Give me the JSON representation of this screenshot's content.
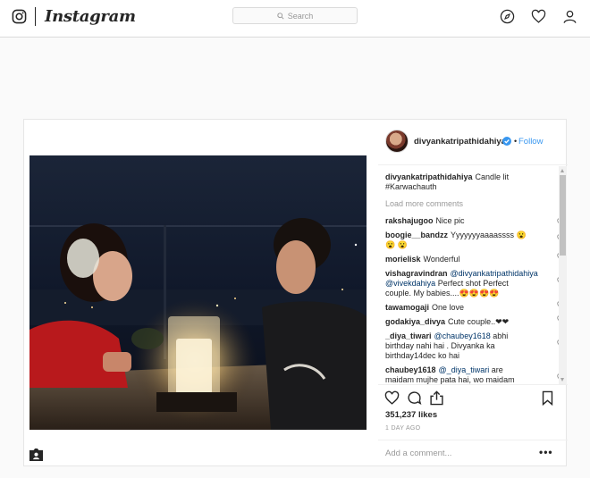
{
  "nav": {
    "brand": "Instagram",
    "search_placeholder": "Search",
    "icons": [
      "instagram-camera-icon",
      "compass-icon",
      "heart-icon",
      "profile-icon"
    ]
  },
  "post": {
    "username": "divyankatripathidahiya",
    "follow_label": "Follow",
    "dot": "•",
    "caption_user": "divyankatripathidahiya",
    "caption_text": "Candle lit #Karwachauth",
    "load_more": "Load more comments",
    "comments": [
      {
        "user": "rakshajugoo",
        "text": "Nice pic"
      },
      {
        "user": "boogie__bandzz",
        "text": "Yyyyyyyaaaassss 😮😮 😮"
      },
      {
        "user": "morielisk",
        "text": "Wonderful"
      },
      {
        "user": "vishagravindran",
        "mention": "@divyankatripathidahiya @vivekdahiya",
        "text": "Perfect shot Perfect couple. My babies....😍😍😍😍"
      },
      {
        "user": "tawamogaji",
        "text": "One love"
      },
      {
        "user": "godakiya_divya",
        "text": "Cute couple..❤❤"
      },
      {
        "user": "_diya_tiwari",
        "mention": "@chaubey1618",
        "text": "abhi birthday nahi hai . Divyanka ka birthday14dec ko hai"
      },
      {
        "user": "chaubey1618",
        "mention": "@_diya_tiwari",
        "text": "are maidam mujhe pata hai, wo maidam"
      }
    ],
    "likes": "351,237 likes",
    "time": "1 DAY AGO",
    "add_comment_placeholder": "Add a comment...",
    "more": "•••"
  },
  "colors": {
    "link": "#3897f0",
    "mention": "#003569",
    "border": "#dbdbdb",
    "background": "#fafafa"
  }
}
